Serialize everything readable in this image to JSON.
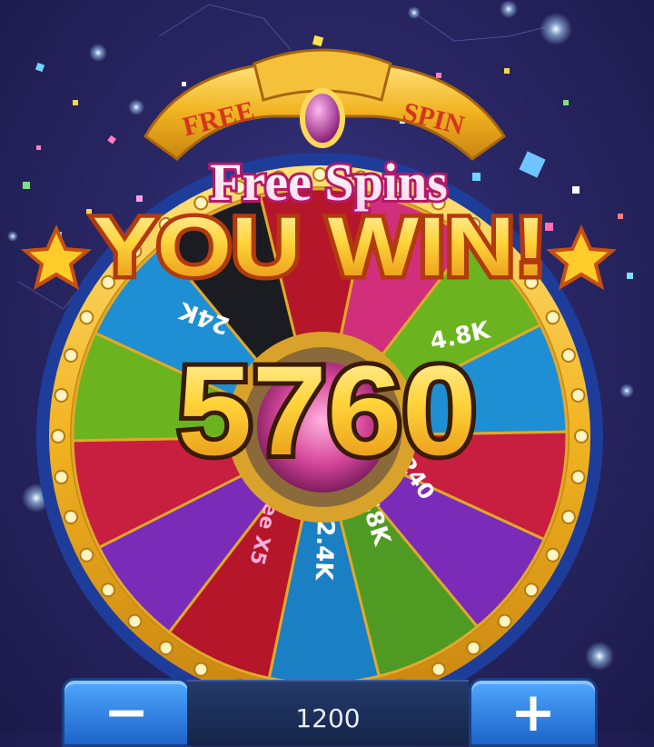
{
  "wheel": {
    "header_left": "FREE",
    "header_right": "SPIN",
    "segments": [
      "24K",
      "4.8K",
      "2.4K",
      "48K",
      "240",
      "Free X5"
    ]
  },
  "win_popup": {
    "subtitle": "Free Spins",
    "title": "YOU WIN!",
    "amount": "5760"
  },
  "bet_controls": {
    "minus_label": "−",
    "plus_label": "+",
    "bet_value": "1200"
  }
}
